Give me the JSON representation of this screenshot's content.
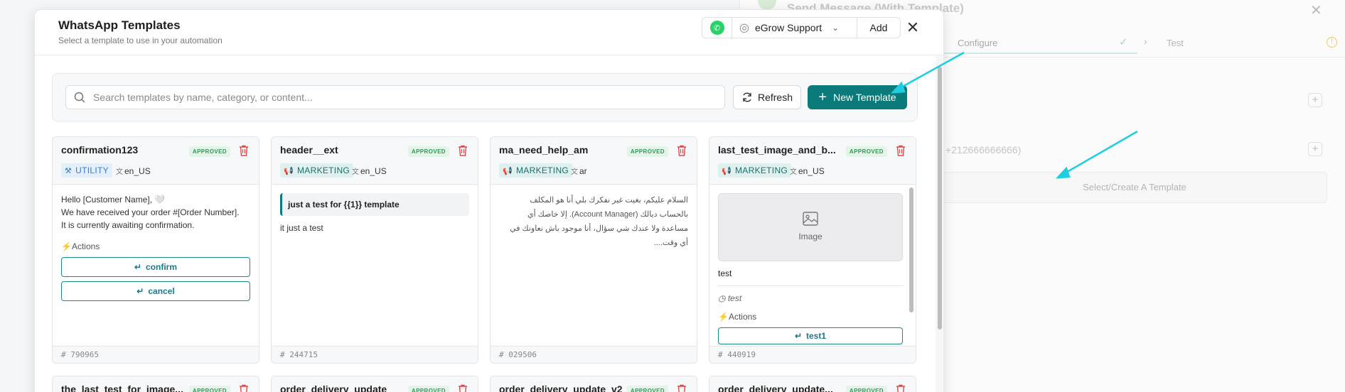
{
  "background": {
    "title": "Send Message (With Template)",
    "steps": [
      {
        "label": "Configure",
        "check": "✓"
      },
      {
        "label": "Test"
      }
    ],
    "phone_placeholder": "+212666666666)",
    "select_template_label": "Select/Create A Template"
  },
  "modal": {
    "title": "WhatsApp Templates",
    "subtitle": "Select a template to use in your automation",
    "account_name": "eGrow Support",
    "add_label": "Add",
    "search_placeholder": "Search templates by name, category, or content...",
    "refresh_label": "Refresh",
    "new_template_label": "New Template"
  },
  "cards": [
    {
      "name": "confirmation123",
      "status": "APPROVED",
      "category": "UTILITY",
      "lang": "en_US",
      "body": [
        "Hello [Customer Name], 🤍",
        "We have received your order #[Order Number].",
        "It is currently awaiting confirmation."
      ],
      "actions_label": "Actions",
      "actions": [
        "confirm",
        "cancel"
      ],
      "id": "# 790965"
    },
    {
      "name": "header__ext",
      "status": "APPROVED",
      "category": "MARKETING",
      "lang": "en_US",
      "header": "just a test for {{1}} template",
      "body": [
        "it just a test"
      ],
      "id": "# 244715"
    },
    {
      "name": "ma_need_help_am",
      "status": "APPROVED",
      "category": "MARKETING",
      "lang": "ar",
      "body": [
        "السلام عليكم، بغيت غير نفكرك بلي أنا هو المكلف",
        "بالحساب ديالك (Account Manager). إلا خاصك أي",
        "مساعدة ولا عندك شي سؤال، أنا موجود باش نعاونك في",
        "أي وقت...."
      ],
      "id": "# 029506"
    },
    {
      "name": "last_test_image_and_b...",
      "status": "APPROVED",
      "category": "MARKETING",
      "lang": "en_US",
      "image_label": "Image",
      "body": [
        "test"
      ],
      "footer": "test",
      "actions_label": "Actions",
      "actions": [
        "test1"
      ],
      "id": "# 440919"
    }
  ],
  "cards_row2": [
    {
      "name": "the_last_test_for_image...",
      "status": "APPROVED"
    },
    {
      "name": "order_delivery_update",
      "status": "APPROVED"
    },
    {
      "name": "order_delivery_update_v2",
      "status": "APPROVED"
    },
    {
      "name": "order_delivery_update...",
      "status": "APPROVED"
    }
  ],
  "colors": {
    "accent": "#0b7a7a",
    "approved": "#2f9a56",
    "delete": "#e04848",
    "whatsapp": "#25d366",
    "arrow": "#1ccfe0"
  }
}
